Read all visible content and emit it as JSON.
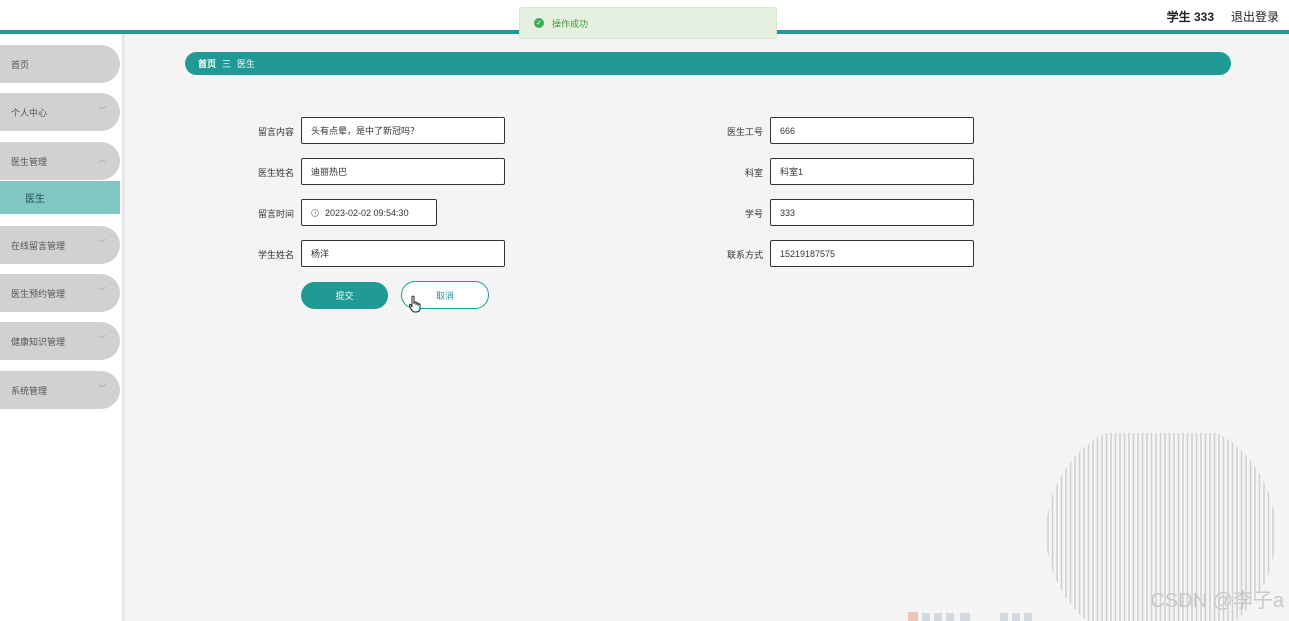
{
  "header": {
    "user_name": "学生 333",
    "logout_label": "退出登录"
  },
  "toast": {
    "message": "操作成功",
    "icon": "success-check-icon"
  },
  "sidebar": {
    "items": [
      {
        "label": "首页"
      },
      {
        "label": "个人中心"
      },
      {
        "label": "医生管理"
      },
      {
        "label": "医生"
      },
      {
        "label": "在线留言管理"
      },
      {
        "label": "医生预约管理"
      },
      {
        "label": "健康知识管理"
      },
      {
        "label": "系统管理"
      }
    ]
  },
  "breadcrumb": {
    "home": "首页",
    "separator": "三",
    "current": "医生"
  },
  "form": {
    "message_content": {
      "label": "留言内容",
      "value": "头有点晕，是中了新冠吗？"
    },
    "doctor_name": {
      "label": "医生姓名",
      "value": "迪丽热巴"
    },
    "message_time": {
      "label": "留言时间",
      "value": "2023-02-02 09:54:30"
    },
    "student_name": {
      "label": "学生姓名",
      "value": "杨洋"
    },
    "doctor_id": {
      "label": "医生工号",
      "value": "666"
    },
    "department": {
      "label": "科室",
      "value": "科室1"
    },
    "student_id": {
      "label": "学号",
      "value": "333"
    },
    "contact": {
      "label": "联系方式",
      "value": "15219187575"
    },
    "submit_label": "提交",
    "cancel_label": "取消"
  },
  "watermark": "CSDN @李子a",
  "colors": {
    "accent": "#1f9a94",
    "sidebar_active": "#7ec7c2",
    "menu_bg": "#d1d1d1",
    "toast_bg": "#e6f0e1"
  }
}
